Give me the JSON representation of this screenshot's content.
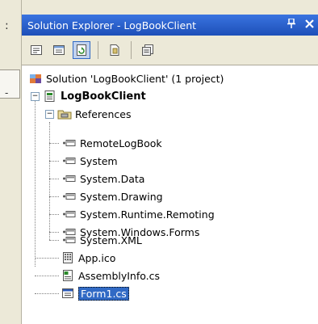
{
  "panel": {
    "title": "Solution Explorer - LogBookClient",
    "pin_glyph": "‒",
    "close_glyph": "✕"
  },
  "toolbar": {
    "buttons": [
      "properties-icon",
      "show-all-files-icon",
      "refresh-icon",
      "view-code-icon",
      "view-designer-icon"
    ]
  },
  "tree": {
    "solution": "Solution 'LogBookClient' (1 project)",
    "project": "LogBookClient",
    "references_folder": "References",
    "references": [
      "RemoteLogBook",
      "System",
      "System.Data",
      "System.Drawing",
      "System.Runtime.Remoting",
      "System.Windows.Forms",
      "System.XML"
    ],
    "files": [
      "App.ico",
      "AssemblyInfo.cs",
      "Form1.cs"
    ],
    "selected": "Form1.cs"
  },
  "colors": {
    "titlebar": "#1f56c4",
    "selection": "#316ac5"
  }
}
